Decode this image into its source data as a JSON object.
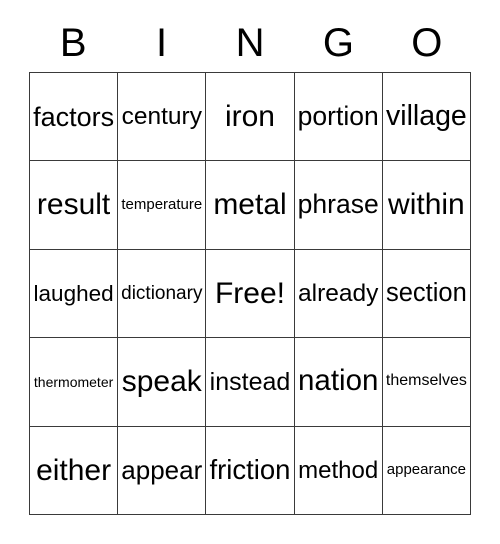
{
  "card": {
    "type": "bingo-card",
    "columns": 5,
    "rows": 5,
    "free_space_index": 12,
    "border_color": "#3a3a3a",
    "background_color": "#ffffff",
    "text_color": "#000000"
  },
  "header": {
    "letters": [
      "B",
      "I",
      "N",
      "G",
      "O"
    ]
  },
  "grid": {
    "rows": [
      {
        "cells": [
          {
            "text": "factors"
          },
          {
            "text": "century"
          },
          {
            "text": "iron"
          },
          {
            "text": "portion"
          },
          {
            "text": "village"
          }
        ]
      },
      {
        "cells": [
          {
            "text": "result"
          },
          {
            "text": "temperature"
          },
          {
            "text": "metal"
          },
          {
            "text": "phrase"
          },
          {
            "text": "within"
          }
        ]
      },
      {
        "cells": [
          {
            "text": "laughed"
          },
          {
            "text": "dictionary"
          },
          {
            "text": "Free!"
          },
          {
            "text": "already"
          },
          {
            "text": "section"
          }
        ]
      },
      {
        "cells": [
          {
            "text": "thermometer"
          },
          {
            "text": "speak"
          },
          {
            "text": "instead"
          },
          {
            "text": "nation"
          },
          {
            "text": "themselves"
          }
        ]
      },
      {
        "cells": [
          {
            "text": "either"
          },
          {
            "text": "appear"
          },
          {
            "text": "friction"
          },
          {
            "text": "method"
          },
          {
            "text": "appearance"
          }
        ]
      }
    ]
  }
}
